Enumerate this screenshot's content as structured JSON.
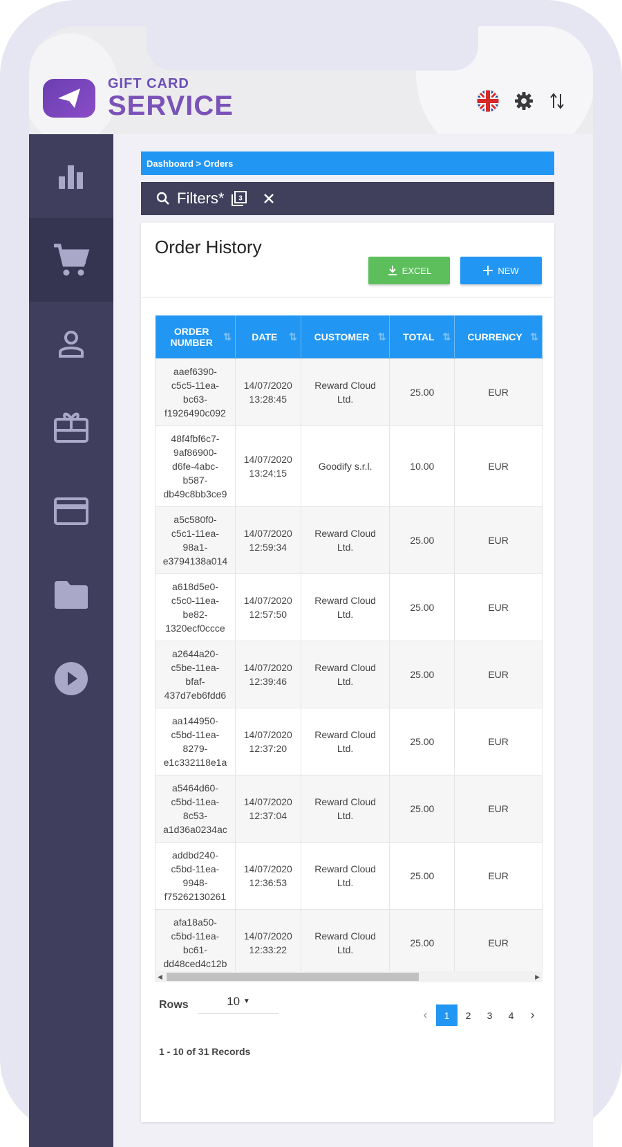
{
  "brand": {
    "line1": "GIFT CARD",
    "line2": "SERVICE"
  },
  "header_icons": [
    "uk-flag-icon",
    "gear-icon",
    "sort-arrows-icon"
  ],
  "sidebar": {
    "items": [
      "bar-chart-icon",
      "cart-icon",
      "user-icon",
      "gift-card-icon",
      "credit-card-icon",
      "folder-icon",
      "play-icon"
    ],
    "active": 1
  },
  "breadcrumb": "Dashboard > Orders",
  "filters": {
    "label": "Filters*"
  },
  "page": {
    "title": "Order History",
    "excel_label": "EXCEL",
    "new_label": "NEW"
  },
  "table": {
    "columns": [
      "ORDER NUMBER",
      "DATE",
      "CUSTOMER",
      "TOTAL",
      "CURRENCY"
    ],
    "rows": [
      {
        "order": [
          "aaef6390-",
          "c5c5-11ea-",
          "bc63-",
          "f1926490c092"
        ],
        "date": [
          "14/07/2020",
          "13:28:45"
        ],
        "customer": [
          "Reward Cloud",
          "Ltd."
        ],
        "total": "25.00",
        "currency": "EUR"
      },
      {
        "order": [
          "48f4fbf6c7-",
          "9af86900-",
          "d6fe-4abc-",
          "b587-",
          "db49c8bb3ce9"
        ],
        "date": [
          "14/07/2020",
          "13:24:15"
        ],
        "customer": [
          "Goodify s.r.l."
        ],
        "total": "10.00",
        "currency": "EUR"
      },
      {
        "order": [
          "a5c580f0-",
          "c5c1-11ea-",
          "98a1-",
          "e3794138a014"
        ],
        "date": [
          "14/07/2020",
          "12:59:34"
        ],
        "customer": [
          "Reward Cloud",
          "Ltd."
        ],
        "total": "25.00",
        "currency": "EUR"
      },
      {
        "order": [
          "a618d5e0-",
          "c5c0-11ea-",
          "be82-",
          "1320ecf0ccce"
        ],
        "date": [
          "14/07/2020",
          "12:57:50"
        ],
        "customer": [
          "Reward Cloud",
          "Ltd."
        ],
        "total": "25.00",
        "currency": "EUR"
      },
      {
        "order": [
          "a2644a20-",
          "c5be-11ea-",
          "bfaf-",
          "437d7eb6fdd6"
        ],
        "date": [
          "14/07/2020",
          "12:39:46"
        ],
        "customer": [
          "Reward Cloud",
          "Ltd."
        ],
        "total": "25.00",
        "currency": "EUR"
      },
      {
        "order": [
          "aa144950-",
          "c5bd-11ea-",
          "8279-",
          "e1c332118e1a"
        ],
        "date": [
          "14/07/2020",
          "12:37:20"
        ],
        "customer": [
          "Reward Cloud",
          "Ltd."
        ],
        "total": "25.00",
        "currency": "EUR"
      },
      {
        "order": [
          "a5464d60-",
          "c5bd-11ea-",
          "8c53-",
          "a1d36a0234ac"
        ],
        "date": [
          "14/07/2020",
          "12:37:04"
        ],
        "customer": [
          "Reward Cloud",
          "Ltd."
        ],
        "total": "25.00",
        "currency": "EUR"
      },
      {
        "order": [
          "addbd240-",
          "c5bd-11ea-",
          "9948-",
          "f75262130261"
        ],
        "date": [
          "14/07/2020",
          "12:36:53"
        ],
        "customer": [
          "Reward Cloud",
          "Ltd."
        ],
        "total": "25.00",
        "currency": "EUR"
      },
      {
        "order": [
          "afa18a50-",
          "c5bd-11ea-",
          "bc61-",
          "dd48ced4c12b"
        ],
        "date": [
          "14/07/2020",
          "12:33:22"
        ],
        "customer": [
          "Reward Cloud",
          "Ltd."
        ],
        "total": "25.00",
        "currency": "EUR"
      }
    ]
  },
  "pagination": {
    "rows_label": "Rows",
    "rows_value": "10",
    "pages": [
      "1",
      "2",
      "3",
      "4"
    ],
    "current": "1",
    "records": "1 - 10 of 31 Records"
  },
  "colors": {
    "primary": "#2196f3",
    "success": "#5cbf5c",
    "sidebar": "#3f3e5c",
    "brand": "#7a52b8"
  }
}
